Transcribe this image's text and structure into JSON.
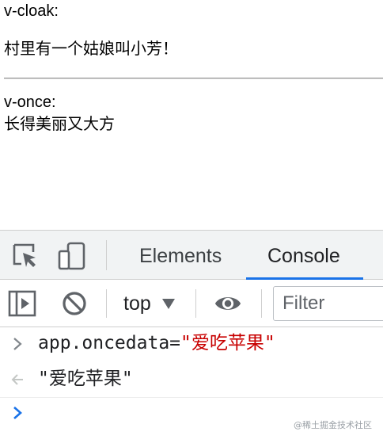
{
  "page": {
    "cloak_label": "v-cloak:",
    "cloak_text": "村里有一个姑娘叫小芳！",
    "once_label": "v-once:",
    "once_text": "长得美丽又大方"
  },
  "devtools": {
    "tabs": [
      {
        "label": "Elements",
        "active": false
      },
      {
        "label": "Console",
        "active": true
      }
    ],
    "toolbar": {
      "context": "top",
      "filter_placeholder": "Filter"
    },
    "console": {
      "input_expression": "app.oncedata=",
      "input_string": "\"爱吃苹果\"",
      "result_string": "\"爱吃苹果\""
    }
  },
  "watermark": "@稀土掘金技术社区",
  "colors": {
    "accent": "#1a73e8",
    "string": "#c80000",
    "prompt": "#1a73e8"
  },
  "icons": [
    "inspect-element-icon",
    "device-toggle-icon",
    "sidebar-toggle-icon",
    "clear-console-icon",
    "eye-icon",
    "chevron-right-icon",
    "result-arrow-icon",
    "prompt-chevron-icon"
  ]
}
